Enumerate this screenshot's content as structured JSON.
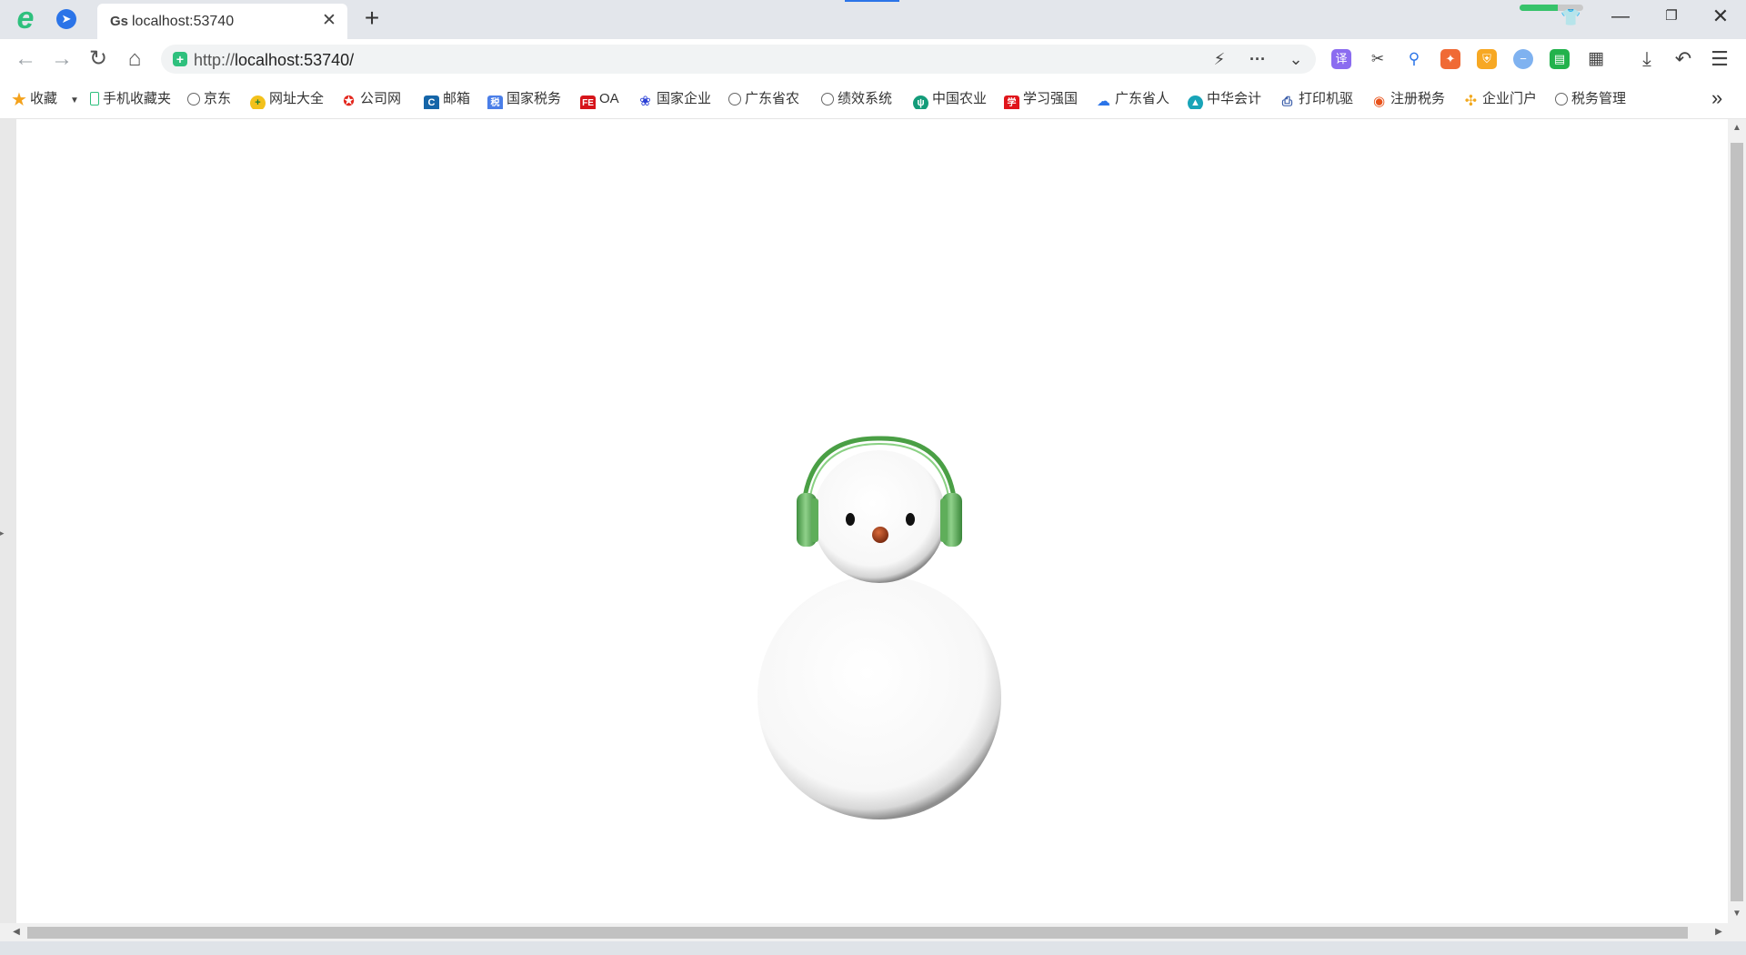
{
  "tab": {
    "favicon_text": "Gs",
    "title": "localhost:53740",
    "close_glyph": "✕",
    "new_tab_glyph": "+"
  },
  "window": {
    "minimize_glyph": "—",
    "maximize_glyph": "❐",
    "close_glyph": "✕",
    "skin_progress": 0.6
  },
  "address": {
    "url": "http://localhost:53740/",
    "url_prefix": "http://",
    "url_host": "localhost:53740/"
  },
  "bookmarks": {
    "items": [
      {
        "label": "收藏",
        "icon": "star-icon"
      },
      {
        "label": "手机收藏夹",
        "icon": "phone-icon"
      },
      {
        "label": "京东",
        "icon": "globe-icon"
      },
      {
        "label": "网址大全",
        "icon": "plus-circle-icon"
      },
      {
        "label": "公司网",
        "icon": "emblem-icon"
      },
      {
        "label": "邮箱",
        "icon": "c-icon"
      },
      {
        "label": "国家税务",
        "icon": "tax-icon"
      },
      {
        "label": "OA",
        "icon": "fe-icon"
      },
      {
        "label": "国家企业",
        "icon": "paw-icon"
      },
      {
        "label": "广东省农",
        "icon": "globe-icon"
      },
      {
        "label": "绩效系统",
        "icon": "globe-icon"
      },
      {
        "label": "中国农业",
        "icon": "agri-icon"
      },
      {
        "label": "学习强国",
        "icon": "xuexi-icon"
      },
      {
        "label": "广东省人",
        "icon": "cloud-icon"
      },
      {
        "label": "中华会计",
        "icon": "account-icon"
      },
      {
        "label": "打印机驱",
        "icon": "printer-icon"
      },
      {
        "label": "注册税务",
        "icon": "weibo-icon"
      },
      {
        "label": "企业门户",
        "icon": "pinwheel-icon"
      },
      {
        "label": "税务管理",
        "icon": "globe-icon"
      }
    ],
    "more_glyph": "»"
  },
  "colors": {
    "accent_green": "#2ec07d",
    "headphone_green": "#5cb85c",
    "nose": "#b5401c"
  }
}
